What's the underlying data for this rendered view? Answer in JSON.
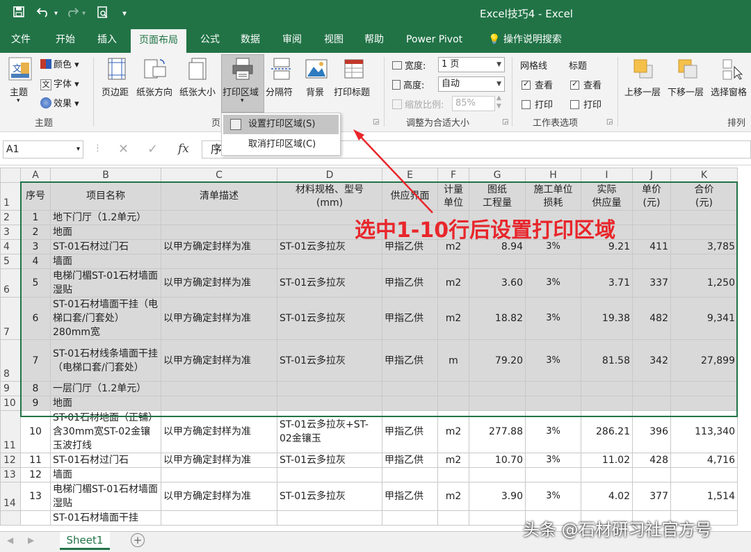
{
  "titlebar": {
    "title": "Excel技巧4  -  Excel",
    "save_icon": "save-icon",
    "undo_icon": "undo-icon",
    "redo_icon": "redo-icon",
    "preview_icon": "print-preview-icon",
    "more_icon": "customize-qat-icon"
  },
  "tabs": [
    "文件",
    "开始",
    "插入",
    "页面布局",
    "公式",
    "数据",
    "审阅",
    "视图",
    "帮助",
    "Power Pivot",
    "操作说明搜索"
  ],
  "active_tab": "页面布局",
  "ribbon": {
    "theme": {
      "button": "主题",
      "colors": "颜色",
      "fonts": "字体",
      "effects": "效果",
      "group": "主题"
    },
    "page_setup": {
      "margins": "页边距",
      "orientation": "纸张方向",
      "size": "纸张大小",
      "print_area": "打印区域",
      "breaks": "分隔符",
      "background": "背景",
      "print_titles": "打印标题",
      "group": "页"
    },
    "scale": {
      "width_label": "宽度:",
      "width_value": "1 页",
      "height_label": "高度:",
      "height_value": "自动",
      "scale_label": "缩放比例:",
      "scale_value": "85%",
      "group": "调整为合适大小"
    },
    "sheet_options": {
      "gridlines": "网格线",
      "headings": "标题",
      "view": "查看",
      "print": "打印",
      "group": "工作表选项"
    },
    "arrange": {
      "bring_forward": "上移一层",
      "send_backward": "下移一层",
      "selection_pane": "选择窗格",
      "group": "排列"
    }
  },
  "dropdown": {
    "set_print_area": "设置打印区域(S)",
    "clear_print_area": "取消打印区域(C)"
  },
  "formula_bar": {
    "name_box": "A1",
    "content": "序"
  },
  "columns": [
    "A",
    "B",
    "C",
    "D",
    "E",
    "F",
    "G",
    "H",
    "I",
    "J",
    "K"
  ],
  "rows": [
    {
      "n": "1",
      "cells": [
        "序号",
        "项目名称",
        "清单描述",
        "材料规格、型号\n(mm)",
        "供应界面",
        "计量\n单位",
        "图纸\n工程量",
        "施工单位\n损耗",
        "实际\n供应量",
        "单价\n(元)",
        "合价\n(元)"
      ]
    },
    {
      "n": "2",
      "cells": [
        "1",
        "地下门厅（1.2单元）",
        "",
        "",
        "",
        "",
        "",
        "",
        "",
        "",
        ""
      ]
    },
    {
      "n": "3",
      "cells": [
        "2",
        "地面",
        "",
        "",
        "",
        "",
        "",
        "",
        "",
        "",
        ""
      ]
    },
    {
      "n": "4",
      "cells": [
        "3",
        "ST-01石材过门石",
        "以甲方确定封样为准",
        "ST-01云多拉灰",
        "甲指乙供",
        "m2",
        "8.94",
        "3%",
        "9.21",
        "411",
        "3,785"
      ]
    },
    {
      "n": "5",
      "cells": [
        "4",
        "墙面",
        "",
        "",
        "",
        "",
        "",
        "",
        "",
        "",
        ""
      ]
    },
    {
      "n": "6",
      "cells": [
        "5",
        "电梯门楣ST-01石材墙面湿贴",
        "以甲方确定封样为准",
        "ST-01云多拉灰",
        "甲指乙供",
        "m2",
        "3.60",
        "3%",
        "3.71",
        "337",
        "1,250"
      ]
    },
    {
      "n": "7",
      "cells": [
        "6",
        "ST-01石材墙面干挂（电梯口套/门套处）280mm宽",
        "以甲方确定封样为准",
        "ST-01云多拉灰",
        "甲指乙供",
        "m2",
        "18.82",
        "3%",
        "19.38",
        "482",
        "9,341"
      ]
    },
    {
      "n": "8",
      "cells": [
        "7",
        "ST-01石材线条墙面干挂（电梯口套/门套处）",
        "以甲方确定封样为准",
        "ST-01云多拉灰",
        "甲指乙供",
        "m",
        "79.20",
        "3%",
        "81.58",
        "342",
        "27,899"
      ]
    },
    {
      "n": "9",
      "cells": [
        "8",
        "一层门厅（1.2单元）",
        "",
        "",
        "",
        "",
        "",
        "",
        "",
        "",
        ""
      ]
    },
    {
      "n": "10",
      "cells": [
        "9",
        "地面",
        "",
        "",
        "",
        "",
        "",
        "",
        "",
        "",
        ""
      ]
    },
    {
      "n": "11",
      "cells": [
        "10",
        "ST-01石材地面（正铺）含30mm宽ST-02金镶玉波打线",
        "以甲方确定封样为准",
        "ST-01云多拉灰+ST-02金镶玉",
        "甲指乙供",
        "m2",
        "277.88",
        "3%",
        "286.21",
        "396",
        "113,340"
      ]
    },
    {
      "n": "12",
      "cells": [
        "11",
        "ST-01石材过门石",
        "以甲方确定封样为准",
        "ST-01云多拉灰",
        "甲指乙供",
        "m2",
        "10.70",
        "3%",
        "11.02",
        "428",
        "4,716"
      ]
    },
    {
      "n": "13",
      "cells": [
        "12",
        "墙面",
        "",
        "",
        "",
        "",
        "",
        "",
        "",
        "",
        ""
      ]
    },
    {
      "n": "14",
      "cells": [
        "13",
        "电梯门楣ST-01石材墙面湿贴",
        "以甲方确定封样为准",
        "ST-01云多拉灰",
        "甲指乙供",
        "m2",
        "3.90",
        "3%",
        "4.02",
        "377",
        "1,514"
      ]
    },
    {
      "n": "",
      "cells": [
        "",
        "ST-01石材墙面干挂",
        "",
        "",
        "",
        "",
        "",
        "",
        "",
        "",
        ""
      ]
    }
  ],
  "annotation": "选中1-10行后设置打印区域",
  "sheet_tab": "Sheet1",
  "watermark": "头条 @石材研习社官方号",
  "colors": {
    "excel_green": "#217346",
    "annotation_red": "#e8262b",
    "selection_gray": "#d9d9d9"
  }
}
